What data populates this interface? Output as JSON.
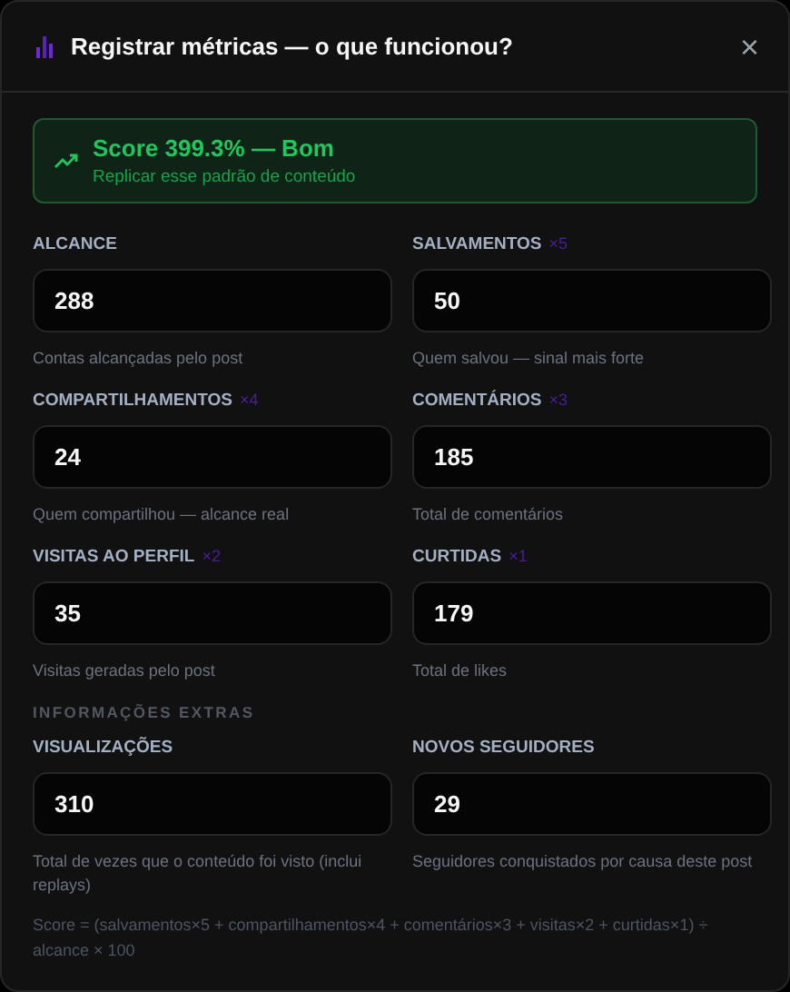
{
  "dialog": {
    "title": "Registrar métricas — o que funcionou?",
    "close": "×"
  },
  "score_banner": {
    "headline": "Score 399.3% — Bom",
    "subtitle": "Replicar esse padrão de conteúdo"
  },
  "metrics": [
    {
      "label": "ALCANCE",
      "value": "288",
      "hint": "Contas alcançadas pelo post"
    },
    {
      "label": "SALVAMENTOS",
      "weight": "×5",
      "value": "50",
      "hint": "Quem salvou — sinal mais forte"
    },
    {
      "label": "COMPARTILHAMENTOS",
      "weight": "×4",
      "value": "24",
      "hint": "Quem compartilhou — alcance real"
    },
    {
      "label": "COMENTÁRIOS",
      "weight": "×3",
      "value": "185",
      "hint": "Total de comentários"
    },
    {
      "label": "VISITAS AO PERFIL",
      "weight": "×2",
      "value": "35",
      "hint": "Visitas geradas pelo post"
    },
    {
      "label": "CURTIDAS",
      "weight": "×1",
      "value": "179",
      "hint": "Total de likes"
    }
  ],
  "extras": {
    "heading": "INFORMAÇÕES EXTRAS",
    "fields": [
      {
        "label": "VISUALIZAÇÕES",
        "value": "310",
        "hint": "Total de vezes que o conteúdo foi visto (inclui replays)"
      },
      {
        "label": "NOVOS SEGUIDORES",
        "value": "29",
        "hint": "Seguidores conquistados por causa deste post"
      }
    ]
  },
  "formula": "Score = (salvamentos×5 + compartilhamentos×4 + comentários×3 + visitas×2 + curtidas×1) ÷ alcance × 100"
}
